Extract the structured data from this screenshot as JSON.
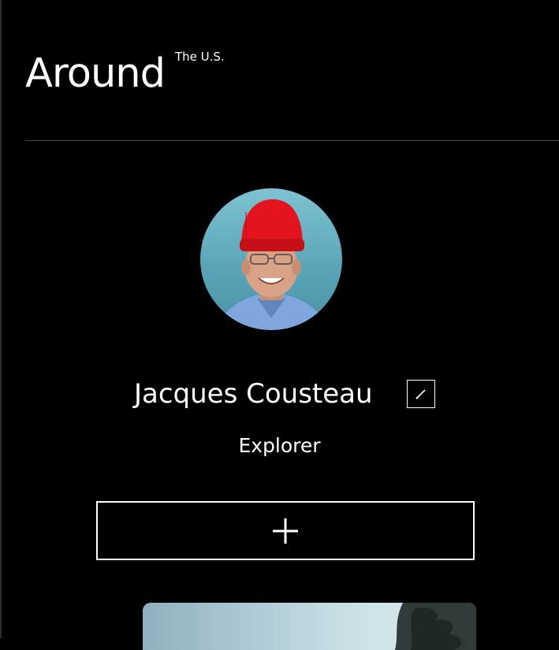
{
  "header": {
    "logo_main": "Around",
    "logo_sup": "The U.S."
  },
  "profile": {
    "name": "Jacques Cousteau",
    "about": "Explorer",
    "avatar_alt": "Jacques Cousteau"
  },
  "icons": {
    "edit": "pencil-icon",
    "add": "plus-icon"
  },
  "colors": {
    "background": "#000000",
    "text": "#ffffff",
    "divider": "#545454"
  }
}
